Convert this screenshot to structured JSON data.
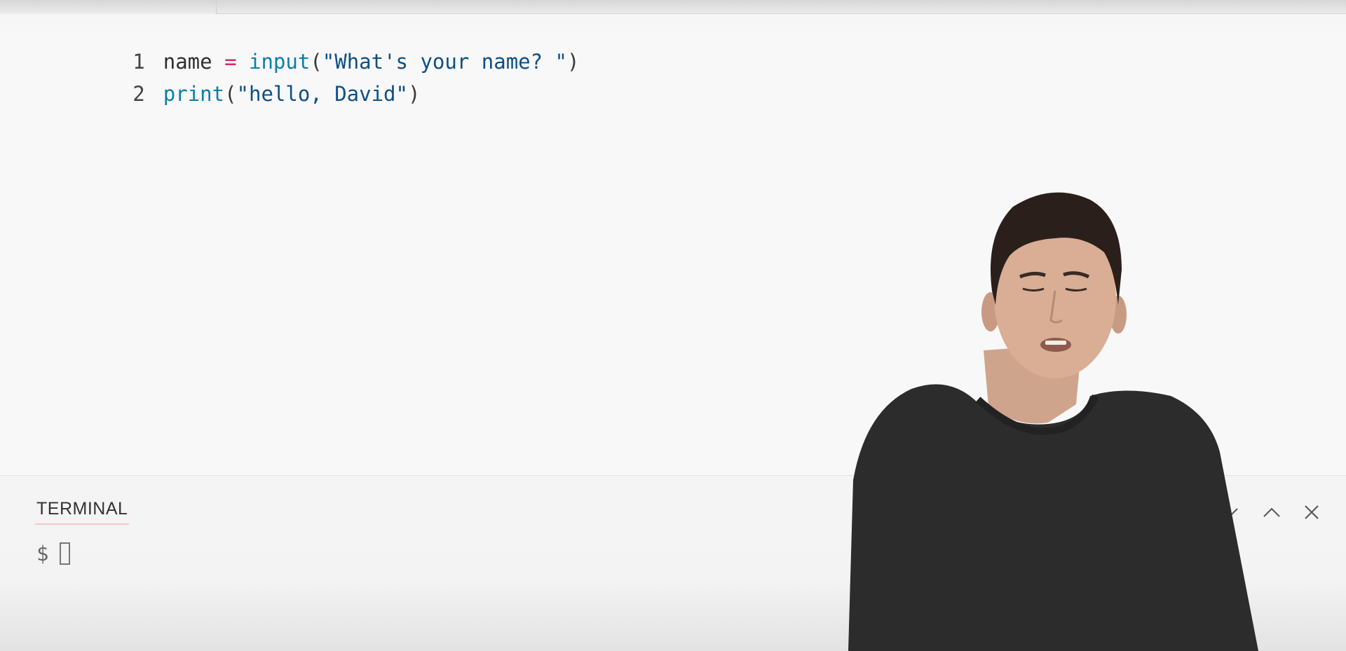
{
  "editor": {
    "lines": [
      {
        "number": "1",
        "tokens": {
          "var": "name",
          "space1": " ",
          "op": "=",
          "space2": " ",
          "fn": "input",
          "open": "(",
          "str": "\"What's your name? \"",
          "close": ")"
        }
      },
      {
        "number": "2",
        "tokens": {
          "fn": "print",
          "open": "(",
          "str": "\"hello, David\"",
          "close": ")"
        }
      }
    ]
  },
  "terminal": {
    "tab_label": "TERMINAL",
    "prompt": "$",
    "buttons": {
      "collapse_icon": "chevron-down-icon",
      "maximize_icon": "chevron-up-icon",
      "close_icon": "close-icon"
    }
  },
  "colors": {
    "keyword_operator": "#e0245e",
    "function": "#0a7fa8",
    "string": "#0d4f86",
    "tab_underline": "#f2c6c6"
  }
}
